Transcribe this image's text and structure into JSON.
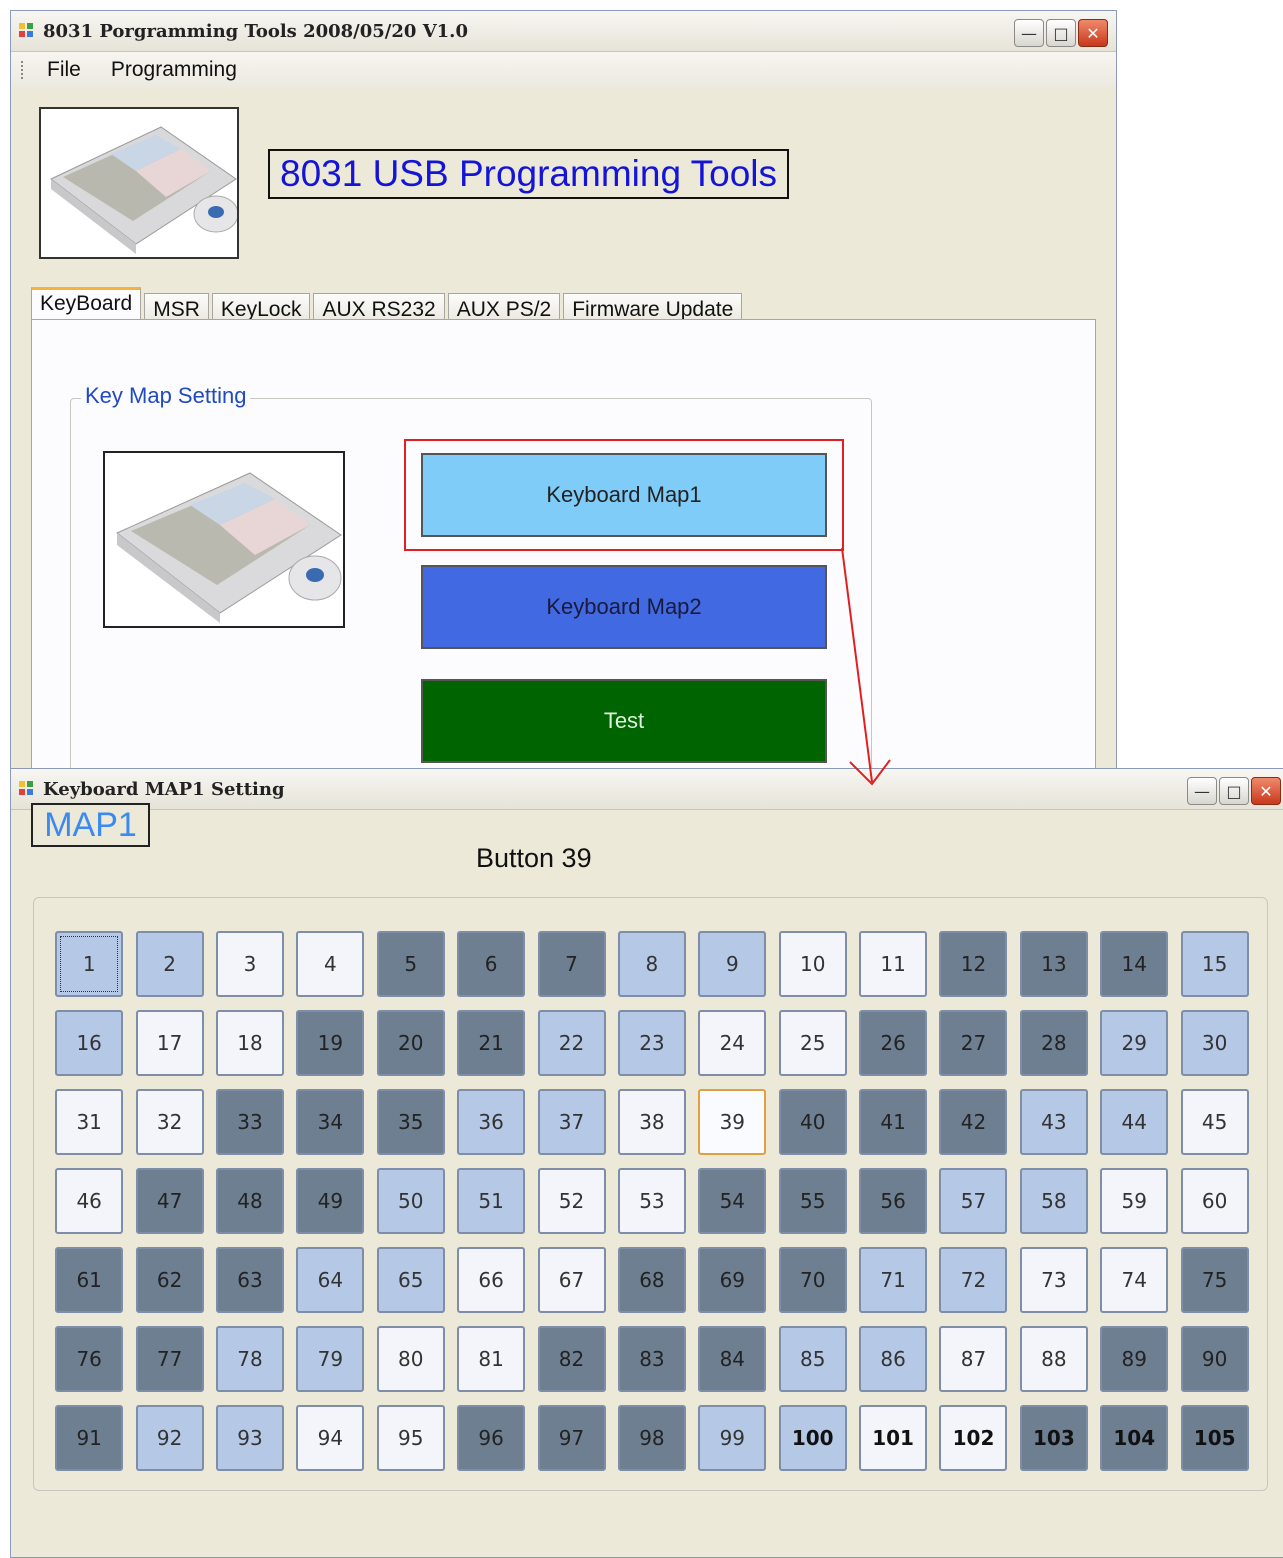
{
  "main_window": {
    "title": "8031 Porgramming Tools 2008/05/20 V1.0",
    "menu": [
      "File",
      "Programming"
    ],
    "app_title": "8031 USB Programming Tools",
    "tabs": [
      "KeyBoard",
      "MSR",
      "KeyLock",
      "AUX RS232",
      "AUX PS/2",
      "Firmware Update"
    ],
    "active_tab": "KeyBoard",
    "group_title": "Key Map Setting",
    "buttons": {
      "map1": {
        "label": "Keyboard Map1",
        "color": "#80ccf8"
      },
      "map2": {
        "label": "Keyboard Map2",
        "color": "#4169e1"
      },
      "test": {
        "label": "Test",
        "color": "#006400"
      }
    },
    "highlight_color": "#e02020"
  },
  "map_window": {
    "title": "Keyboard MAP1 Setting",
    "map_label": "MAP1",
    "status": "Button 39",
    "selected_key": 39,
    "focused_key": 1,
    "keys": [
      {
        "n": "1",
        "s": "l"
      },
      {
        "n": "2",
        "s": "l"
      },
      {
        "n": "3",
        "s": "w"
      },
      {
        "n": "4",
        "s": "w"
      },
      {
        "n": "5",
        "s": "d"
      },
      {
        "n": "6",
        "s": "d"
      },
      {
        "n": "7",
        "s": "d"
      },
      {
        "n": "8",
        "s": "l"
      },
      {
        "n": "9",
        "s": "l"
      },
      {
        "n": "10",
        "s": "w"
      },
      {
        "n": "11",
        "s": "w"
      },
      {
        "n": "12",
        "s": "d"
      },
      {
        "n": "13",
        "s": "d"
      },
      {
        "n": "14",
        "s": "d"
      },
      {
        "n": "15",
        "s": "l"
      },
      {
        "n": "16",
        "s": "l"
      },
      {
        "n": "17",
        "s": "w"
      },
      {
        "n": "18",
        "s": "w"
      },
      {
        "n": "19",
        "s": "d"
      },
      {
        "n": "20",
        "s": "d"
      },
      {
        "n": "21",
        "s": "d"
      },
      {
        "n": "22",
        "s": "l"
      },
      {
        "n": "23",
        "s": "l"
      },
      {
        "n": "24",
        "s": "w"
      },
      {
        "n": "25",
        "s": "w"
      },
      {
        "n": "26",
        "s": "d"
      },
      {
        "n": "27",
        "s": "d"
      },
      {
        "n": "28",
        "s": "d"
      },
      {
        "n": "29",
        "s": "l"
      },
      {
        "n": "30",
        "s": "l"
      },
      {
        "n": "31",
        "s": "w"
      },
      {
        "n": "32",
        "s": "w"
      },
      {
        "n": "33",
        "s": "d"
      },
      {
        "n": "34",
        "s": "d"
      },
      {
        "n": "35",
        "s": "d"
      },
      {
        "n": "36",
        "s": "l"
      },
      {
        "n": "37",
        "s": "l"
      },
      {
        "n": "38",
        "s": "w"
      },
      {
        "n": "39",
        "s": "w"
      },
      {
        "n": "40",
        "s": "d"
      },
      {
        "n": "41",
        "s": "d"
      },
      {
        "n": "42",
        "s": "d"
      },
      {
        "n": "43",
        "s": "l"
      },
      {
        "n": "44",
        "s": "l"
      },
      {
        "n": "45",
        "s": "w"
      },
      {
        "n": "46",
        "s": "w"
      },
      {
        "n": "47",
        "s": "d"
      },
      {
        "n": "48",
        "s": "d"
      },
      {
        "n": "49",
        "s": "d"
      },
      {
        "n": "50",
        "s": "l"
      },
      {
        "n": "51",
        "s": "l"
      },
      {
        "n": "52",
        "s": "w"
      },
      {
        "n": "53",
        "s": "w"
      },
      {
        "n": "54",
        "s": "d"
      },
      {
        "n": "55",
        "s": "d"
      },
      {
        "n": "56",
        "s": "d"
      },
      {
        "n": "57",
        "s": "l"
      },
      {
        "n": "58",
        "s": "l"
      },
      {
        "n": "59",
        "s": "w"
      },
      {
        "n": "60",
        "s": "w"
      },
      {
        "n": "61",
        "s": "d"
      },
      {
        "n": "62",
        "s": "d"
      },
      {
        "n": "63",
        "s": "d"
      },
      {
        "n": "64",
        "s": "l"
      },
      {
        "n": "65",
        "s": "l"
      },
      {
        "n": "66",
        "s": "w"
      },
      {
        "n": "67",
        "s": "w"
      },
      {
        "n": "68",
        "s": "d"
      },
      {
        "n": "69",
        "s": "d"
      },
      {
        "n": "70",
        "s": "d"
      },
      {
        "n": "71",
        "s": "l"
      },
      {
        "n": "72",
        "s": "l"
      },
      {
        "n": "73",
        "s": "w"
      },
      {
        "n": "74",
        "s": "w"
      },
      {
        "n": "75",
        "s": "d"
      },
      {
        "n": "76",
        "s": "d"
      },
      {
        "n": "77",
        "s": "d"
      },
      {
        "n": "78",
        "s": "l"
      },
      {
        "n": "79",
        "s": "l"
      },
      {
        "n": "80",
        "s": "w"
      },
      {
        "n": "81",
        "s": "w"
      },
      {
        "n": "82",
        "s": "d"
      },
      {
        "n": "83",
        "s": "d"
      },
      {
        "n": "84",
        "s": "d"
      },
      {
        "n": "85",
        "s": "l"
      },
      {
        "n": "86",
        "s": "l"
      },
      {
        "n": "87",
        "s": "w"
      },
      {
        "n": "88",
        "s": "w"
      },
      {
        "n": "89",
        "s": "d"
      },
      {
        "n": "90",
        "s": "d"
      },
      {
        "n": "91",
        "s": "d"
      },
      {
        "n": "92",
        "s": "l"
      },
      {
        "n": "93",
        "s": "l"
      },
      {
        "n": "94",
        "s": "w"
      },
      {
        "n": "95",
        "s": "w"
      },
      {
        "n": "96",
        "s": "d"
      },
      {
        "n": "97",
        "s": "d"
      },
      {
        "n": "98",
        "s": "d"
      },
      {
        "n": "99",
        "s": "l"
      },
      {
        "n": "100",
        "s": "l"
      },
      {
        "n": "101",
        "s": "w"
      },
      {
        "n": "102",
        "s": "w"
      },
      {
        "n": "103",
        "s": "d"
      },
      {
        "n": "104",
        "s": "d"
      },
      {
        "n": "105",
        "s": "d"
      }
    ]
  },
  "icons": [
    "app-icon",
    "minimize-icon",
    "maximize-icon",
    "close-icon",
    "keyboard-image",
    "arrow-icon"
  ]
}
